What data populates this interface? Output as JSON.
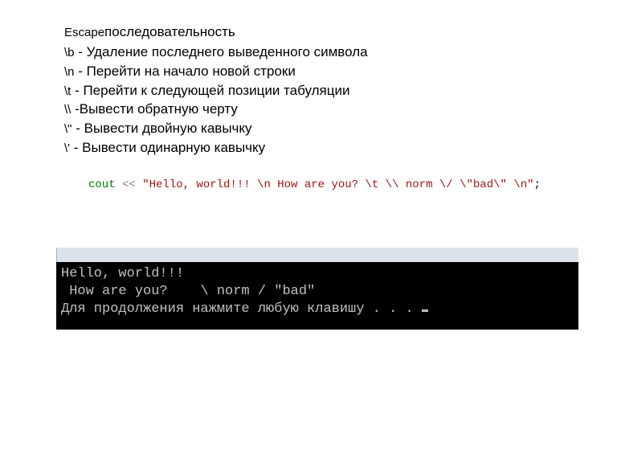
{
  "title": {
    "escape": "Escape",
    "word": "последовательность"
  },
  "lines": [
    {
      "code": "\\b",
      "sep": "  - ",
      "desc": "Удаление последнего выведенного символа"
    },
    {
      "code": "\\n",
      "sep": " -  ",
      "desc": "Перейти на начало новой строки"
    },
    {
      "code": "\\t",
      "sep": " - ",
      "desc": "Перейти к следующей позиции табуляции"
    },
    {
      "code": "\\\\",
      "sep": "  -",
      "desc": "Вывести обратную черту"
    },
    {
      "code": " \\\"",
      "sep": " - ",
      "desc": "Вывести двойную кавычку"
    },
    {
      "code": " \\'",
      "sep": "  - ",
      "desc": "Вывести одинарную кавычку"
    }
  ],
  "code": {
    "cout": "cout",
    "op": " << ",
    "string": "\"Hello, world!!! \\n How are you? \\t \\\\ norm \\/ \\\"bad\\\" \\n\"",
    "semi": ";"
  },
  "console": {
    "titlebar": "",
    "line1": "Hello, world!!!",
    "line2": " How are you?    \\ norm / \"bad\"",
    "line3": "Для продолжения нажмите любую клавишу . . . "
  }
}
